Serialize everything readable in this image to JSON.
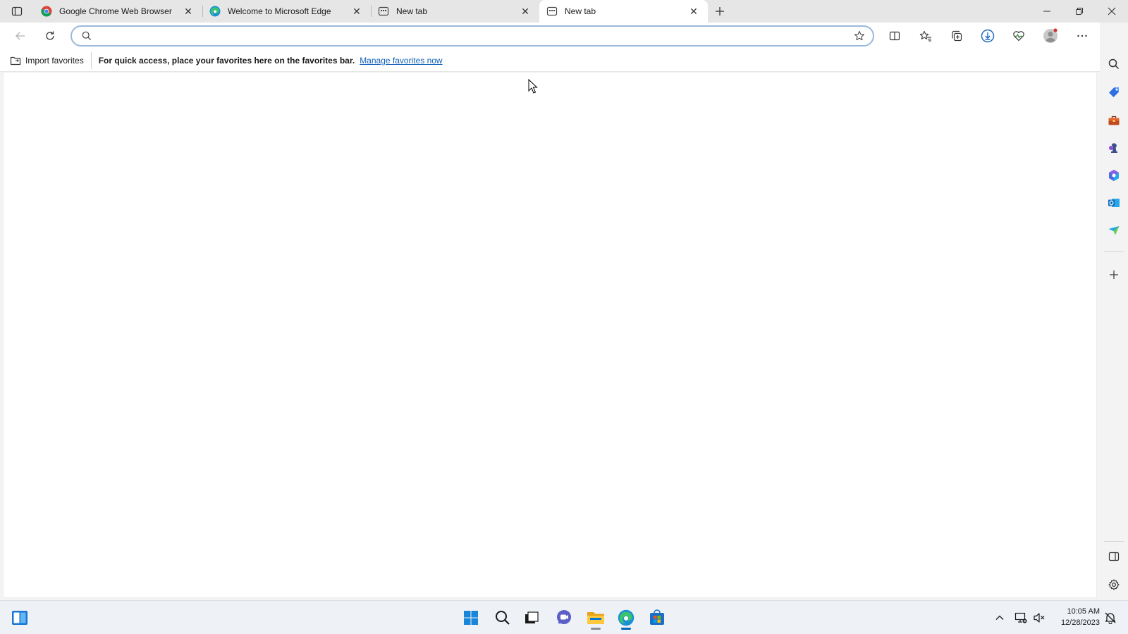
{
  "tabs": [
    {
      "title": "Google Chrome Web Browser",
      "favicon": "chrome-icon",
      "active": false
    },
    {
      "title": "Welcome to Microsoft Edge",
      "favicon": "edge-icon",
      "active": false
    },
    {
      "title": "New tab",
      "favicon": "newtab-page-icon",
      "active": false
    },
    {
      "title": "New tab",
      "favicon": "newtab-page-icon",
      "active": true
    }
  ],
  "toolbar": {
    "address_value": "",
    "address_placeholder": ""
  },
  "favorites_bar": {
    "import_label": "Import favorites",
    "message": "For quick access, place your favorites here on the favorites bar.",
    "manage_link": "Manage favorites now"
  },
  "taskbar": {
    "time": "10:05 AM",
    "date": "12/28/2023"
  },
  "colors": {
    "accent": "#0067c0",
    "link": "#0f5fb8",
    "omnibox_border": "#9ab8dc"
  }
}
